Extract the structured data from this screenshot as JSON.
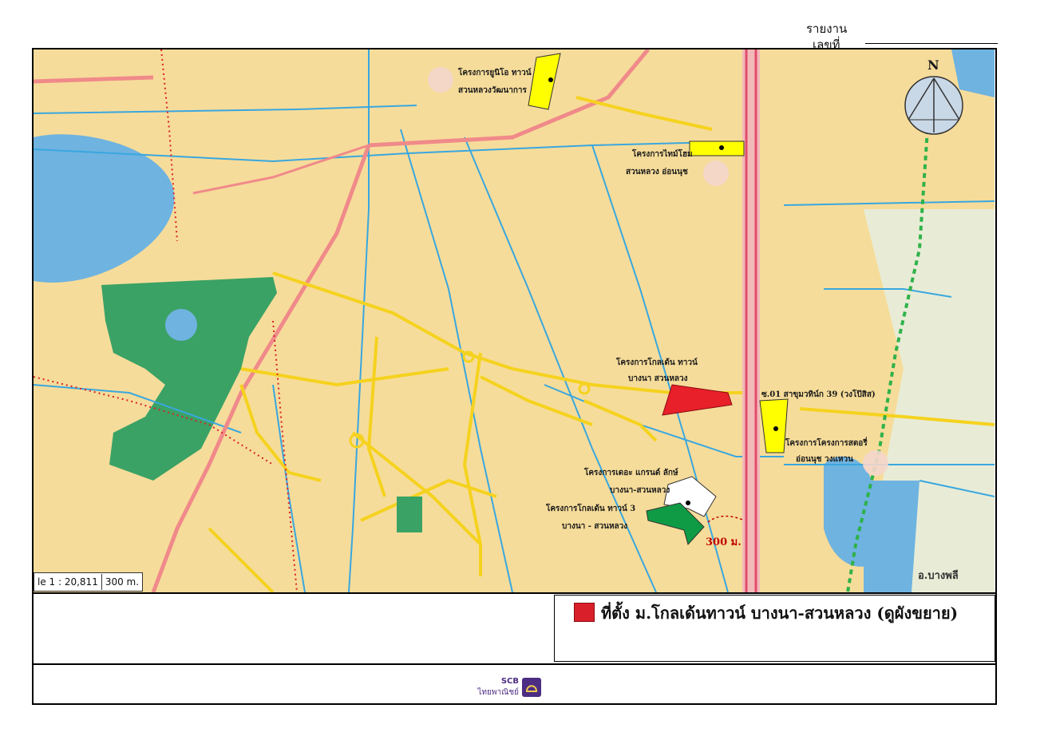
{
  "header": {
    "report_label": "รายงาน",
    "report_no_label": "เลขที่"
  },
  "map": {
    "north_label": "N",
    "scale_ratio": "le 1 : 20,811",
    "scale_bar": "300 m.",
    "distance_label": "300 ม.",
    "labels": {
      "unio_1": "โครงการยูนิโอ ทาวน์",
      "unio_2": "สวนหลวงวัฒนาการ",
      "time_1": "โครงการไทม์โฮม",
      "time_2": "สวนหลวง อ่อนนุช",
      "golden_1": "โครงการโกลเด้น ทาวน์",
      "golden_2": "บางนา สวนหลวง",
      "grand_1": "โครงการเดอะ แกรนด์ ลักษ์",
      "grand_2": "บางนา-สวนหลวง",
      "golden3_1": "โครงการโกลเด้น ทาวน์ 3",
      "golden3_2": "บางนา - สวนหลวง",
      "soi_label": "ซ.01 สาขุมวทิน์ก 39 (วงโป๊สิส)",
      "east_1": "โครงการโครงการสตอรี่",
      "east_2": "อ่อนนุช วงแหวน",
      "district": "อ.บางพลี"
    }
  },
  "legend": {
    "text": "ที่ตั้ง ม.โกลเด้นทาวน์ บางนา-สวนหลวง (ดูผังขยาย)",
    "color": "#d9202a"
  },
  "footer": {
    "logo_en": "SCB",
    "logo_th": "ไทยพาณิชย์"
  },
  "colors": {
    "map_bg": "#f6dc9a",
    "road_yellow": "#f5d21e",
    "road_pink": "#f08a8a",
    "water": "#6fb3e0",
    "canal": "#39a7df",
    "park": "#3aa265",
    "highway": "#e24c6a",
    "site_red": "#e8202a",
    "project_yellow": "#ffff00",
    "project_green": "#0f9b45"
  }
}
